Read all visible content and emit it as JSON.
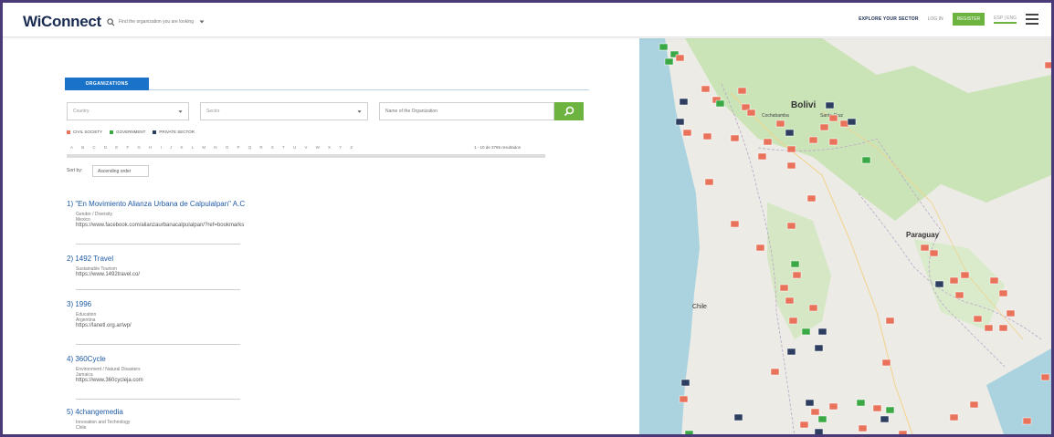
{
  "header": {
    "logo": "WiConnect",
    "search_placeholder": "Find the organization you are looking",
    "nav": {
      "explore": "EXPLORE YOUR SECTOR",
      "login": "LOG IN",
      "register": "REGISTER",
      "language": "ESP | ENG"
    }
  },
  "filters": {
    "tab": "ORGANIZATIONS",
    "country": "Country",
    "sector": "Sector",
    "name_placeholder": "Name of the Organization"
  },
  "legend": [
    {
      "label": "CIVIL SOCIETY",
      "color": "#e8735a"
    },
    {
      "label": "GOVERNMENT",
      "color": "#3aa845"
    },
    {
      "label": "PRIVATE SECTOR",
      "color": "#2d3e60"
    }
  ],
  "alphabet": [
    "A",
    "B",
    "C",
    "D",
    "E",
    "F",
    "G",
    "H",
    "I",
    "J",
    "K",
    "L",
    "M",
    "N",
    "O",
    "P",
    "Q",
    "R",
    "S",
    "T",
    "U",
    "V",
    "W",
    "X",
    "Y",
    "Z"
  ],
  "results": "1 - 10 de 3765 resultados",
  "sort": {
    "label": "Sort by:",
    "value": "Ascending order"
  },
  "organizations": [
    {
      "title": "1) \"En Movimiento Alianza Urbana de Calpulalpan\" A.C",
      "meta": [
        "Gender / Diversity",
        "Mexico"
      ],
      "url": "https://www.facebook.com/alianzaurbanacalpulalpan/?ref=bookmarks"
    },
    {
      "title": "2) 1492 Travel",
      "meta": [
        "Sustainable Tourism"
      ],
      "url": "https://www.1492travel.co/"
    },
    {
      "title": "3) 1996",
      "meta": [
        "Education",
        "Argentina"
      ],
      "url": "https://lanetl.org.ar/wp/"
    },
    {
      "title": "4) 360Cycle",
      "meta": [
        "Environment / Natural Disasters",
        "Jamaica"
      ],
      "url": "https://www.360cycleja.com"
    },
    {
      "title": "5) 4changemedia",
      "meta": [
        "Innovation and Technology",
        "Chile"
      ],
      "url": ""
    }
  ],
  "map": {
    "labels": [
      "Bolivi",
      "Cochabamba",
      "Santa Cruz",
      "Paraguay",
      "Chile"
    ],
    "colors": {
      "land": "#ecebe6",
      "green": "#c6e3b2",
      "water": "#aad3df"
    }
  }
}
